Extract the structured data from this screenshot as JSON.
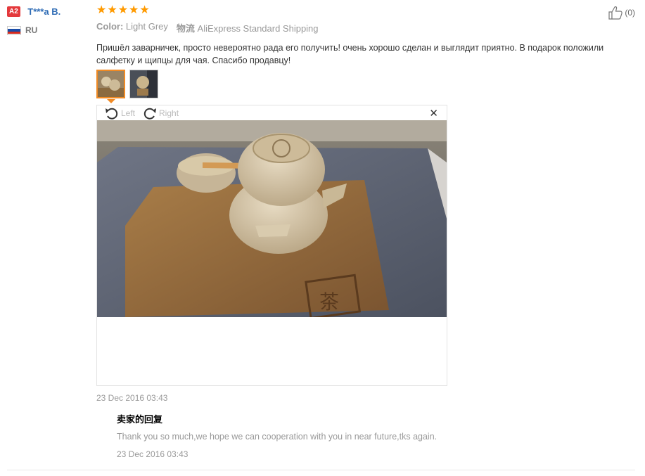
{
  "user": {
    "level": "A2",
    "name": "T***a B.",
    "country": "RU"
  },
  "review": {
    "stars": 5,
    "color_label": "Color:",
    "color_value": "Light Grey",
    "shipping_label": "物流",
    "shipping_value": "AliExpress Standard Shipping",
    "text": "Пришёл заварничек, просто невероятно рада его получить! очень хорошо сделан и выглядит приятно. В подарок положили салфетку и щипцы для чая. Спасибо продавцу!",
    "date": "23 Dec 2016 03:43"
  },
  "helpful": {
    "count": "(0)"
  },
  "viewer": {
    "left_label": "Left",
    "right_label": "Right",
    "close_glyph": "✕"
  },
  "reply": {
    "title": "卖家的回复",
    "text": "Thank you so much,we hope we can cooperation with you in near future,tks again.",
    "date": "23 Dec 2016 03:43"
  },
  "colors": {
    "star": "#ff9a00",
    "accent": "#f08a24",
    "username": "#2f6cb5",
    "badge": "#e4393c"
  }
}
